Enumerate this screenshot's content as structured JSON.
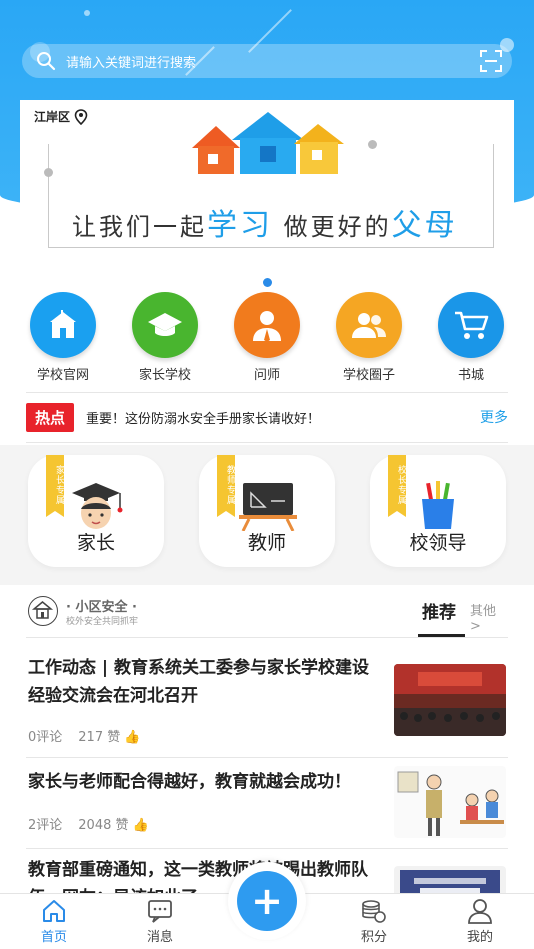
{
  "search": {
    "placeholder": "请输入关键词进行搜索"
  },
  "banner": {
    "location": "江岸区",
    "slogan_pre": "让我们一起",
    "slogan_hl1": "学习",
    "slogan_mid": "做更好的",
    "slogan_hl2": "父母"
  },
  "quick_menu": [
    {
      "label": "学校官网",
      "icon": "school-icon",
      "color": "#1aa0f0"
    },
    {
      "label": "家长学校",
      "icon": "graduation-cap-icon",
      "color": "#49b52f"
    },
    {
      "label": "问师",
      "icon": "teacher-icon",
      "color": "#f17b1d"
    },
    {
      "label": "学校圈子",
      "icon": "people-icon",
      "color": "#f5a623"
    },
    {
      "label": "书城",
      "icon": "cart-icon",
      "color": "#1a96e8"
    }
  ],
  "hot": {
    "tag": "热点",
    "text": "重要！这份防溺水安全手册家长请收好！",
    "more": "更多"
  },
  "roles": [
    {
      "title": "家长",
      "ribbon": "家长专属"
    },
    {
      "title": "教师",
      "ribbon": "教师专属"
    },
    {
      "title": "校领导",
      "ribbon": "校长专属"
    }
  ],
  "section": {
    "name": "· 小区安全 ·",
    "sub": "校外安全共同抓牢",
    "tab_active": "推荐",
    "tab_other": "其他 >"
  },
  "news": [
    {
      "headline": "工作动态 | 教育系统关工委参与家长学校建设经验交流会在河北召开",
      "comments": "0评论",
      "likes": "217 赞"
    },
    {
      "headline": "家长与老师配合得越好，教育就越会成功！",
      "comments": "2评论",
      "likes": "2048 赞"
    },
    {
      "headline": "教育部重磅通知，这一类教师将被踢出教师队伍，网友：早该如此了",
      "comments": "",
      "likes": ""
    }
  ],
  "tabbar": {
    "home": "首页",
    "messages": "消息",
    "fab": "+",
    "points": "积分",
    "mine": "我的"
  },
  "colors": {
    "primary": "#2a8be8",
    "hot_red": "#e8232b",
    "ribbon": "#f5c531"
  }
}
